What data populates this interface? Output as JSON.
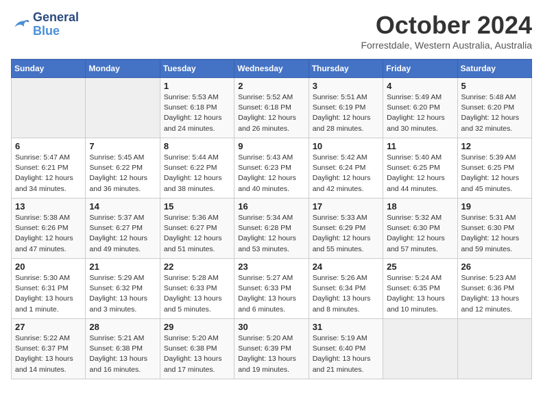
{
  "logo": {
    "line1": "General",
    "line2": "Blue"
  },
  "title": "October 2024",
  "subtitle": "Forrestdale, Western Australia, Australia",
  "weekdays": [
    "Sunday",
    "Monday",
    "Tuesday",
    "Wednesday",
    "Thursday",
    "Friday",
    "Saturday"
  ],
  "weeks": [
    [
      {
        "day": "",
        "info": ""
      },
      {
        "day": "",
        "info": ""
      },
      {
        "day": "1",
        "info": "Sunrise: 5:53 AM\nSunset: 6:18 PM\nDaylight: 12 hours\nand 24 minutes."
      },
      {
        "day": "2",
        "info": "Sunrise: 5:52 AM\nSunset: 6:18 PM\nDaylight: 12 hours\nand 26 minutes."
      },
      {
        "day": "3",
        "info": "Sunrise: 5:51 AM\nSunset: 6:19 PM\nDaylight: 12 hours\nand 28 minutes."
      },
      {
        "day": "4",
        "info": "Sunrise: 5:49 AM\nSunset: 6:20 PM\nDaylight: 12 hours\nand 30 minutes."
      },
      {
        "day": "5",
        "info": "Sunrise: 5:48 AM\nSunset: 6:20 PM\nDaylight: 12 hours\nand 32 minutes."
      }
    ],
    [
      {
        "day": "6",
        "info": "Sunrise: 5:47 AM\nSunset: 6:21 PM\nDaylight: 12 hours\nand 34 minutes."
      },
      {
        "day": "7",
        "info": "Sunrise: 5:45 AM\nSunset: 6:22 PM\nDaylight: 12 hours\nand 36 minutes."
      },
      {
        "day": "8",
        "info": "Sunrise: 5:44 AM\nSunset: 6:22 PM\nDaylight: 12 hours\nand 38 minutes."
      },
      {
        "day": "9",
        "info": "Sunrise: 5:43 AM\nSunset: 6:23 PM\nDaylight: 12 hours\nand 40 minutes."
      },
      {
        "day": "10",
        "info": "Sunrise: 5:42 AM\nSunset: 6:24 PM\nDaylight: 12 hours\nand 42 minutes."
      },
      {
        "day": "11",
        "info": "Sunrise: 5:40 AM\nSunset: 6:25 PM\nDaylight: 12 hours\nand 44 minutes."
      },
      {
        "day": "12",
        "info": "Sunrise: 5:39 AM\nSunset: 6:25 PM\nDaylight: 12 hours\nand 45 minutes."
      }
    ],
    [
      {
        "day": "13",
        "info": "Sunrise: 5:38 AM\nSunset: 6:26 PM\nDaylight: 12 hours\nand 47 minutes."
      },
      {
        "day": "14",
        "info": "Sunrise: 5:37 AM\nSunset: 6:27 PM\nDaylight: 12 hours\nand 49 minutes."
      },
      {
        "day": "15",
        "info": "Sunrise: 5:36 AM\nSunset: 6:27 PM\nDaylight: 12 hours\nand 51 minutes."
      },
      {
        "day": "16",
        "info": "Sunrise: 5:34 AM\nSunset: 6:28 PM\nDaylight: 12 hours\nand 53 minutes."
      },
      {
        "day": "17",
        "info": "Sunrise: 5:33 AM\nSunset: 6:29 PM\nDaylight: 12 hours\nand 55 minutes."
      },
      {
        "day": "18",
        "info": "Sunrise: 5:32 AM\nSunset: 6:30 PM\nDaylight: 12 hours\nand 57 minutes."
      },
      {
        "day": "19",
        "info": "Sunrise: 5:31 AM\nSunset: 6:30 PM\nDaylight: 12 hours\nand 59 minutes."
      }
    ],
    [
      {
        "day": "20",
        "info": "Sunrise: 5:30 AM\nSunset: 6:31 PM\nDaylight: 13 hours\nand 1 minute."
      },
      {
        "day": "21",
        "info": "Sunrise: 5:29 AM\nSunset: 6:32 PM\nDaylight: 13 hours\nand 3 minutes."
      },
      {
        "day": "22",
        "info": "Sunrise: 5:28 AM\nSunset: 6:33 PM\nDaylight: 13 hours\nand 5 minutes."
      },
      {
        "day": "23",
        "info": "Sunrise: 5:27 AM\nSunset: 6:33 PM\nDaylight: 13 hours\nand 6 minutes."
      },
      {
        "day": "24",
        "info": "Sunrise: 5:26 AM\nSunset: 6:34 PM\nDaylight: 13 hours\nand 8 minutes."
      },
      {
        "day": "25",
        "info": "Sunrise: 5:24 AM\nSunset: 6:35 PM\nDaylight: 13 hours\nand 10 minutes."
      },
      {
        "day": "26",
        "info": "Sunrise: 5:23 AM\nSunset: 6:36 PM\nDaylight: 13 hours\nand 12 minutes."
      }
    ],
    [
      {
        "day": "27",
        "info": "Sunrise: 5:22 AM\nSunset: 6:37 PM\nDaylight: 13 hours\nand 14 minutes."
      },
      {
        "day": "28",
        "info": "Sunrise: 5:21 AM\nSunset: 6:38 PM\nDaylight: 13 hours\nand 16 minutes."
      },
      {
        "day": "29",
        "info": "Sunrise: 5:20 AM\nSunset: 6:38 PM\nDaylight: 13 hours\nand 17 minutes."
      },
      {
        "day": "30",
        "info": "Sunrise: 5:20 AM\nSunset: 6:39 PM\nDaylight: 13 hours\nand 19 minutes."
      },
      {
        "day": "31",
        "info": "Sunrise: 5:19 AM\nSunset: 6:40 PM\nDaylight: 13 hours\nand 21 minutes."
      },
      {
        "day": "",
        "info": ""
      },
      {
        "day": "",
        "info": ""
      }
    ]
  ]
}
